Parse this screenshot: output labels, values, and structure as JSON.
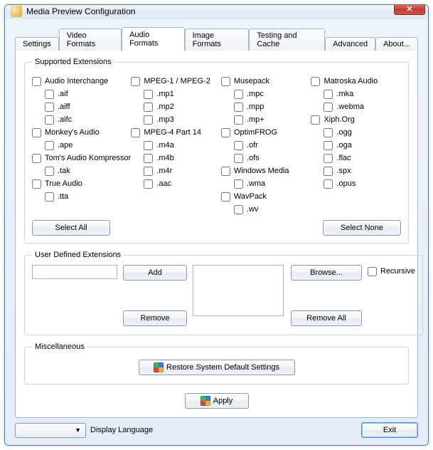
{
  "window": {
    "title": "Media Preview Configuration"
  },
  "tabs": {
    "settings": "Settings",
    "video": "Video Formats",
    "audio": "Audio Formats",
    "image": "Image Formats",
    "testing": "Testing and Cache",
    "advanced": "Advanced",
    "about": "About..."
  },
  "supported": {
    "legend": "Supported Extensions",
    "col1": {
      "g1": {
        "label": "Audio Interchange",
        "items": [
          ".aif",
          ".aiff",
          ".aifc"
        ]
      },
      "g2": {
        "label": "Monkey's Audio",
        "items": [
          ".ape"
        ]
      },
      "g3": {
        "label": "Tom's Audio Kompressor",
        "items": [
          ".tak"
        ]
      },
      "g4": {
        "label": "True Audio",
        "items": [
          ".tta"
        ]
      }
    },
    "col2": {
      "g1": {
        "label": "MPEG-1 / MPEG-2",
        "items": [
          ".mp1",
          ".mp2",
          ".mp3"
        ]
      },
      "g2": {
        "label": "MPEG-4 Part 14",
        "items": [
          ".m4a",
          ".m4b",
          ".m4r",
          ".aac"
        ]
      }
    },
    "col3": {
      "g1": {
        "label": "Musepack",
        "items": [
          ".mpc",
          ".mpp",
          ".mp+"
        ]
      },
      "g2": {
        "label": "OptimFROG",
        "items": [
          ".ofr",
          ".ofs"
        ]
      },
      "g3": {
        "label": "Windows Media",
        "items": [
          ".wma"
        ]
      },
      "g4": {
        "label": "WavPack",
        "items": [
          ".wv"
        ]
      }
    },
    "col4": {
      "g1": {
        "label": "Matroska Audio",
        "items": [
          ".mka",
          ".webma"
        ]
      },
      "g2": {
        "label": "Xiph.Org",
        "items": [
          ".ogg",
          ".oga",
          ".flac",
          ".spx",
          ".opus"
        ]
      }
    },
    "select_all": "Select All",
    "select_none": "Select None"
  },
  "ude": {
    "legend": "User Defined Extensions",
    "add": "Add",
    "remove": "Remove",
    "browse": "Browse...",
    "recursive": "Recursive",
    "remove_all": "Remove All"
  },
  "misc": {
    "legend": "Miscellaneous",
    "restore": "Restore System Default Settings"
  },
  "apply": "Apply",
  "footer": {
    "lang_label": "Display Language",
    "exit": "Exit"
  }
}
